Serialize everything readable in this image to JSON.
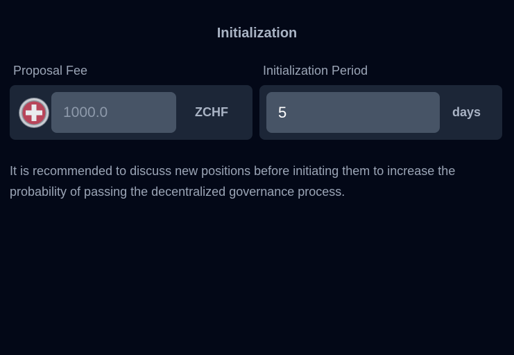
{
  "section": {
    "title": "Initialization"
  },
  "proposal_fee": {
    "label": "Proposal Fee",
    "value": "",
    "placeholder": "1000.0",
    "currency": "ZCHF",
    "currency_icon": "swiss-franc-coin-icon"
  },
  "initialization_period": {
    "label": "Initialization Period",
    "value": "5",
    "unit": "days"
  },
  "note": {
    "text": "It is recommended to discuss new positions before initiating them to increase the probability of passing the decentralized governance process."
  },
  "colors": {
    "background": "#030817",
    "card": "#1c2637",
    "input": "#475466",
    "coin_red": "#b8455a"
  }
}
